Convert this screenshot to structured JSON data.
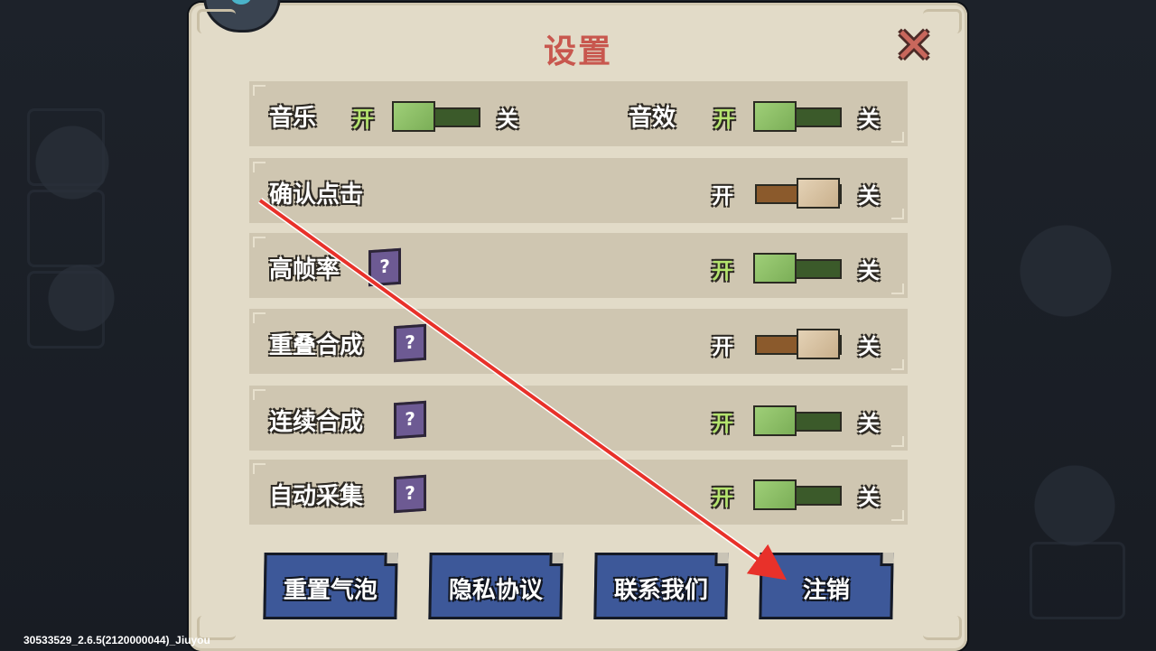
{
  "dialog": {
    "title": "设置",
    "close_icon": "close-x-icon"
  },
  "settings": [
    {
      "id": "music",
      "label": "音乐",
      "on": "开",
      "off": "关",
      "state": "on"
    },
    {
      "id": "sfx",
      "label": "音效",
      "on": "开",
      "off": "关",
      "state": "on"
    },
    {
      "id": "confirm-click",
      "label": "确认点击",
      "on": "开",
      "off": "关",
      "state": "off"
    },
    {
      "id": "high-fps",
      "label": "高帧率",
      "help": "?",
      "on": "开",
      "off": "关",
      "state": "on"
    },
    {
      "id": "stack-merge",
      "label": "重叠合成",
      "help": "?",
      "on": "开",
      "off": "关",
      "state": "off"
    },
    {
      "id": "continuous-merge",
      "label": "连续合成",
      "help": "?",
      "on": "开",
      "off": "关",
      "state": "on"
    },
    {
      "id": "auto-collect",
      "label": "自动采集",
      "help": "?",
      "on": "开",
      "off": "关",
      "state": "on"
    }
  ],
  "buttons": [
    {
      "id": "reset-bubble",
      "label": "重置气泡"
    },
    {
      "id": "privacy",
      "label": "隐私协议"
    },
    {
      "id": "contact",
      "label": "联系我们"
    },
    {
      "id": "logout",
      "label": "注销"
    }
  ],
  "version_text": "30533529_2.6.5(2120000044)_Jiuyou",
  "colors": {
    "panel": "#e2dbc8",
    "row": "#cfc6b1",
    "title": "#c8574e",
    "toggle_on": "#7bae57",
    "toggle_off": "#8b5a2c",
    "button": "#3d5899",
    "annotation_arrow": "#e8312a"
  }
}
